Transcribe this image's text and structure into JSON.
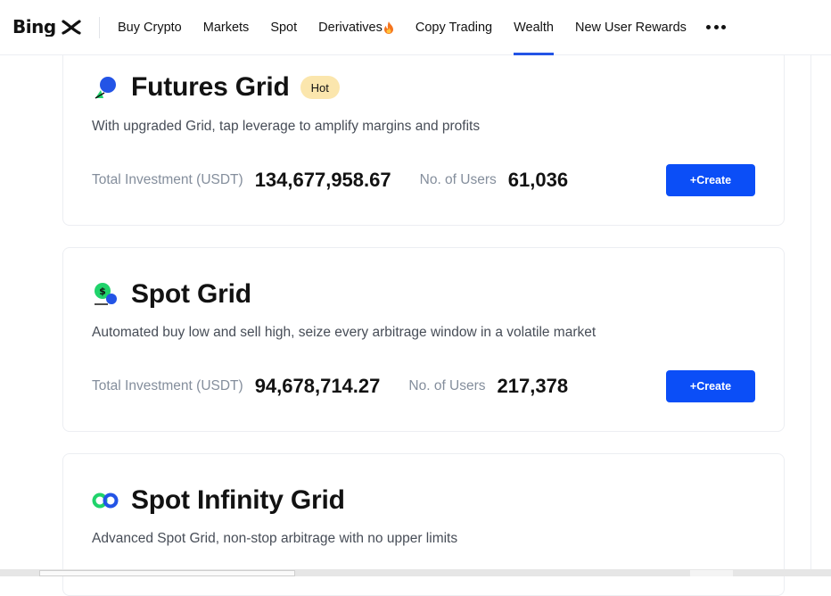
{
  "brand": {
    "logo_text": "BingX"
  },
  "nav": {
    "items": [
      {
        "label": "Buy Crypto",
        "active": false
      },
      {
        "label": "Markets",
        "active": false
      },
      {
        "label": "Spot",
        "active": false
      },
      {
        "label": "Derivatives",
        "active": false,
        "icon": "flame-icon"
      },
      {
        "label": "Copy Trading",
        "active": false
      },
      {
        "label": "Wealth",
        "active": true
      },
      {
        "label": "New User Rewards",
        "active": false
      }
    ],
    "more_icon": "more-horizontal-icon"
  },
  "products": [
    {
      "title": "Futures Grid",
      "badge": "Hot",
      "description": "With upgraded Grid, tap leverage to amplify margins and profits",
      "investment_label": "Total Investment (USDT)",
      "investment_value": "134,677,958.67",
      "users_label": "No. of Users",
      "users_value": "61,036",
      "button_label": "+Create",
      "icon": "futures-grid-icon"
    },
    {
      "title": "Spot Grid",
      "description": "Automated buy low and sell high, seize every arbitrage window in a volatile market",
      "investment_label": "Total Investment (USDT)",
      "investment_value": "94,678,714.27",
      "users_label": "No. of Users",
      "users_value": "217,378",
      "button_label": "+Create",
      "icon": "spot-grid-icon"
    },
    {
      "title": "Spot Infinity Grid",
      "description": "Advanced Spot Grid, non-stop arbitrage with no upper limits",
      "icon": "spot-infinity-grid-icon"
    }
  ],
  "colors": {
    "accent": "#0b4ef7",
    "nav_underline": "#2354e6",
    "hot_badge": "#fbe6ad",
    "green": "#20d36b"
  }
}
